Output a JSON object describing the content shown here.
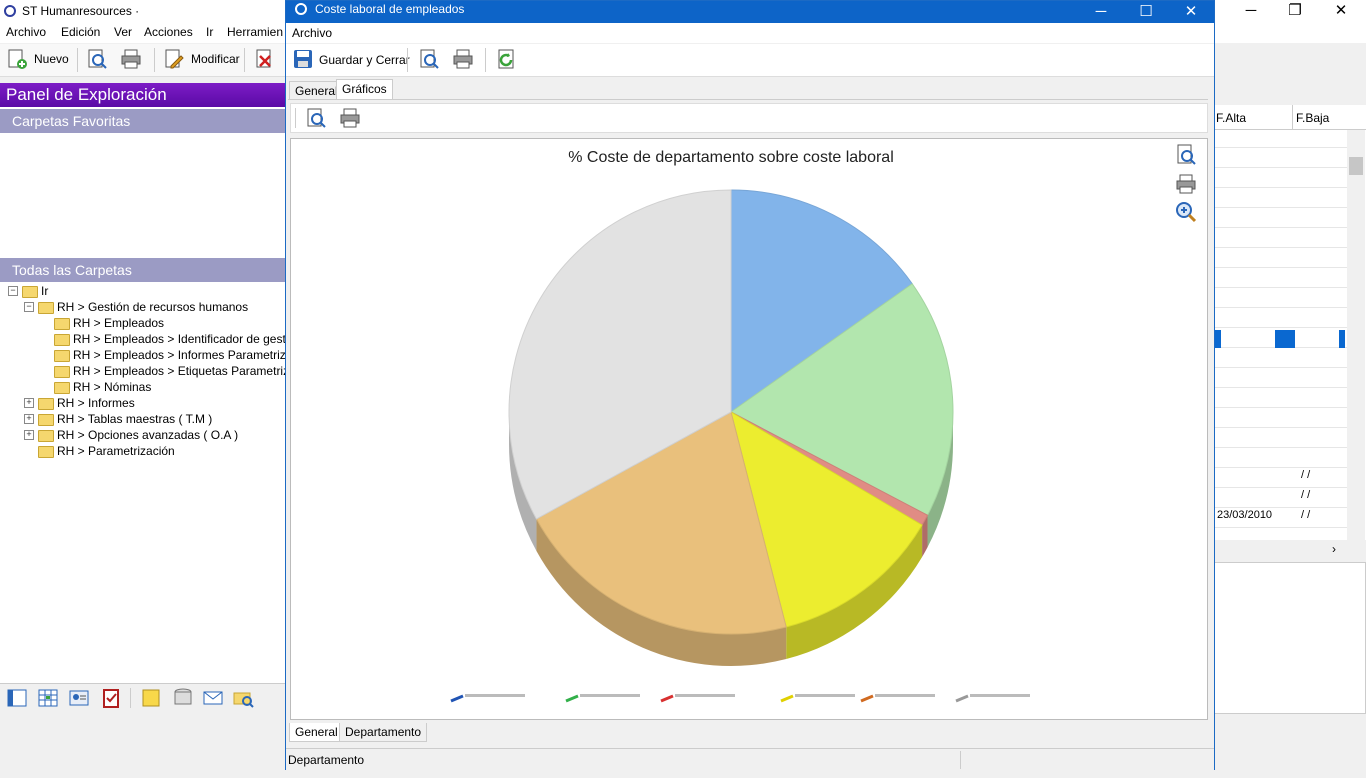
{
  "main_window": {
    "title": "ST Humanresources ·",
    "menu": [
      "Archivo",
      "Edición",
      "Ver",
      "Acciones",
      "Ir",
      "Herramien"
    ],
    "toolbar": {
      "new_label": "Nuevo",
      "modify_label": "Modificar"
    }
  },
  "explorer": {
    "title": "Panel de Exploración",
    "favorites_title": "Carpetas Favoritas",
    "all_folders_title": "Todas las Carpetas",
    "tree": [
      {
        "label": "Ir",
        "level": 0,
        "expander": "−"
      },
      {
        "label": "RH > Gestión de recursos humanos",
        "level": 1,
        "expander": "−"
      },
      {
        "label": "RH > Empleados",
        "level": 2,
        "expander": ""
      },
      {
        "label": "RH > Empleados > Identificador de gestión",
        "level": 2,
        "expander": ""
      },
      {
        "label": "RH > Empleados > Informes Parametrizables",
        "level": 2,
        "expander": ""
      },
      {
        "label": "RH > Empleados > Etiquetas Parametrizables",
        "level": 2,
        "expander": ""
      },
      {
        "label": "RH > Nóminas",
        "level": 2,
        "expander": ""
      },
      {
        "label": "RH > Informes",
        "level": 1,
        "expander": "+"
      },
      {
        "label": "RH > Tablas maestras ( T.M )",
        "level": 1,
        "expander": "+"
      },
      {
        "label": "RH > Opciones avanzadas ( O.A )",
        "level": 1,
        "expander": "+"
      },
      {
        "label": "RH > Parametrización",
        "level": 1,
        "expander": ""
      }
    ]
  },
  "background_grid": {
    "columns": [
      "F.Alta",
      "F.Baja"
    ],
    "last_rows": [
      {
        "alta": "",
        "baja": "/ /"
      },
      {
        "alta": "",
        "baja": "/ /"
      },
      {
        "alta": "23/03/2010",
        "baja": "/ /"
      }
    ]
  },
  "dialog": {
    "title": "Coste laboral de empleados",
    "menu": [
      "Archivo"
    ],
    "toolbar": {
      "save_close_label": "Guardar y Cerrar"
    },
    "tabs": [
      "General",
      "Gráficos"
    ],
    "active_tab": "Gráficos",
    "bottom_tabs": [
      "General",
      "Departamento"
    ],
    "status_text": "Departamento"
  },
  "chart_data": {
    "type": "pie",
    "title": "% Coste de departamento sobre coste laboral",
    "slices": [
      {
        "value": 15.2,
        "color": "#82b4ea"
      },
      {
        "value": 17.5,
        "color": "#b2e6ae"
      },
      {
        "value": 0.8,
        "color": "#e08c84"
      },
      {
        "value": 12.5,
        "color": "#eced2f"
      },
      {
        "value": 21.0,
        "color": "#e9c07c"
      },
      {
        "value": 33.0,
        "color": "#e2e2e2"
      }
    ],
    "legend_colors": [
      "#2054b4",
      "#32b04a",
      "#d83030",
      "#e0d000",
      "#d06a20",
      "#999999"
    ],
    "legend_position": "bottom"
  }
}
